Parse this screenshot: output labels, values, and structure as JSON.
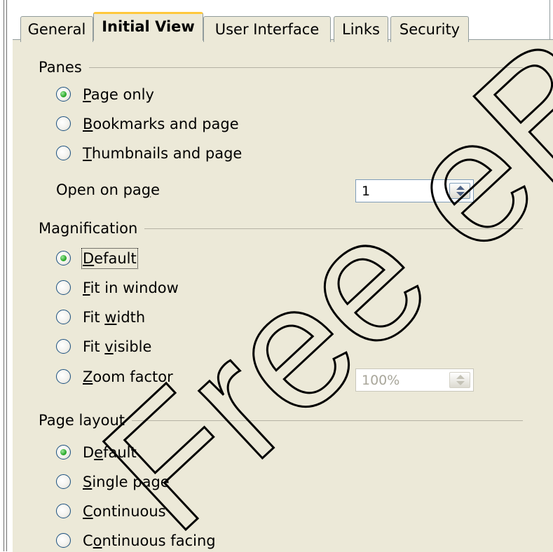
{
  "tabs": [
    {
      "label": "General"
    },
    {
      "label": "Initial View",
      "active": true
    },
    {
      "label": "User Interface"
    },
    {
      "label": "Links"
    },
    {
      "label": "Security"
    }
  ],
  "panes": {
    "title": "Panes",
    "options": [
      {
        "pre": "",
        "key": "P",
        "post": "age only",
        "selected": true
      },
      {
        "pre": "",
        "key": "B",
        "post": "ookmarks and page",
        "selected": false
      },
      {
        "pre": "",
        "key": "T",
        "post": "humbnails and page",
        "selected": false
      }
    ],
    "open_on_page": {
      "pre": "Open on pa",
      "key": "g",
      "post": "e",
      "value": "1"
    }
  },
  "magnification": {
    "title": "Magnification",
    "options": [
      {
        "pre": "",
        "key": "D",
        "post": "efault",
        "selected": true,
        "focused": true
      },
      {
        "pre": "",
        "key": "F",
        "post": "it in window",
        "selected": false
      },
      {
        "pre": "Fit ",
        "key": "w",
        "post": "idth",
        "selected": false
      },
      {
        "pre": "Fit ",
        "key": "v",
        "post": "isible",
        "selected": false
      },
      {
        "pre": "",
        "key": "Z",
        "post": "oom factor",
        "selected": false
      }
    ],
    "zoom_value": "100%"
  },
  "page_layout": {
    "title": "Page layout",
    "options": [
      {
        "pre": "D",
        "key": "e",
        "post": "fault",
        "selected": true
      },
      {
        "pre": "",
        "key": "S",
        "post": "ingle page",
        "selected": false
      },
      {
        "pre": "",
        "key": "C",
        "post": "ontinuous",
        "selected": false
      },
      {
        "pre": "C",
        "key": "o",
        "post": "ntinuous facing",
        "selected": false
      }
    ]
  },
  "watermark": {
    "text": "Free eBook Edition",
    "color": "#000000"
  },
  "colors": {
    "dialog_bg": "#ece9d8",
    "active_tab_accent": "#ffc83c",
    "radio_selected": "#2dab2d"
  }
}
